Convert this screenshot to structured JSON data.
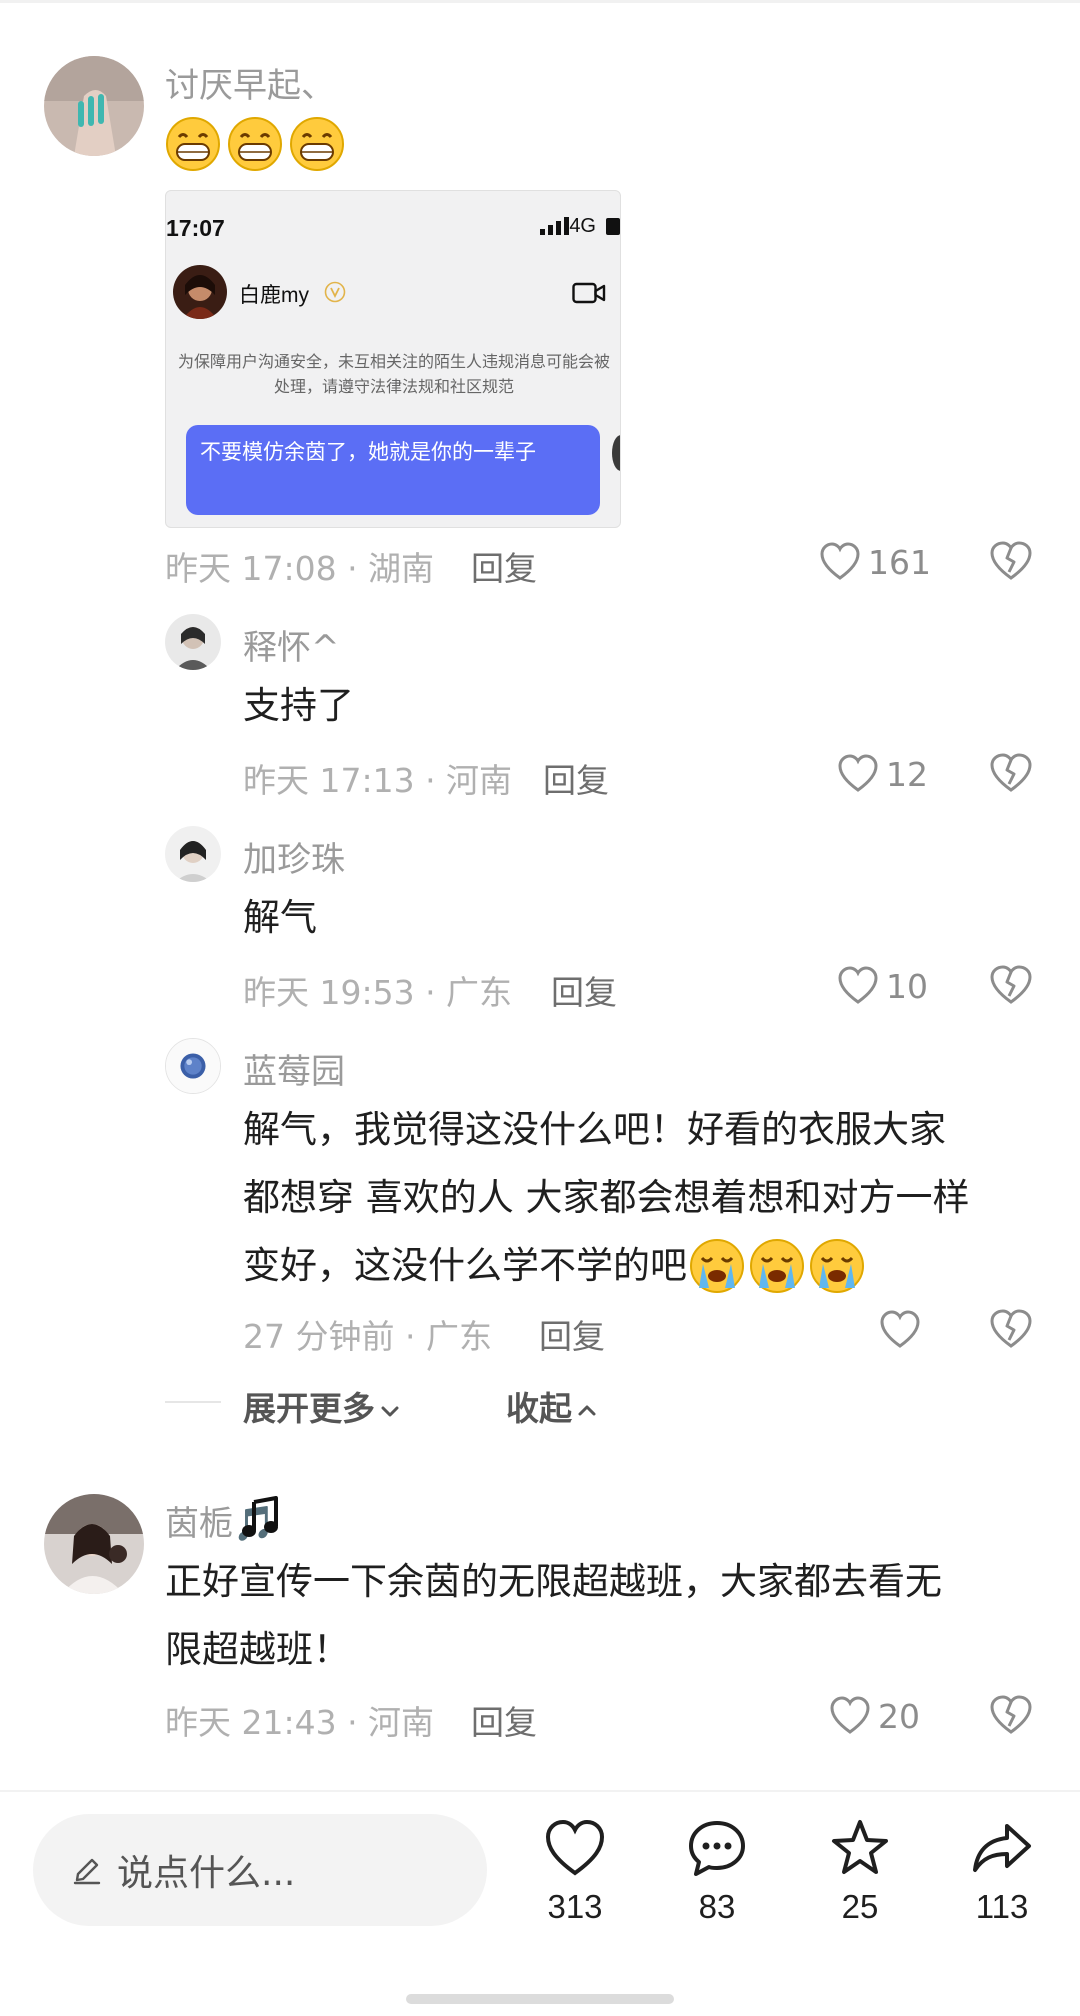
{
  "comments": [
    {
      "username": "讨厌早起、",
      "emoji_text": "😁😁😁",
      "emojis": [
        "grin-emoji",
        "grin-emoji",
        "grin-emoji"
      ],
      "screenshot": {
        "time": "17:07",
        "network": "4G",
        "contact_name": "白鹿my",
        "notice": "为保障用户沟通安全，未互相关注的陌生人违规消息可能会被处理，请遵守法律法规和社区规范",
        "message": "不要模仿余茵了，她就是你的一辈子"
      },
      "meta": "昨天 17:08 · 湖南",
      "reply_label": "回复",
      "likes": "161"
    },
    {
      "username": "释怀^",
      "text": "支持了",
      "meta": "昨天 17:13 · 河南",
      "reply_label": "回复",
      "likes": "12"
    },
    {
      "username": "加珍珠",
      "text": "解气",
      "meta": "昨天 19:53 · 广东",
      "reply_label": "回复",
      "likes": "10"
    },
    {
      "username": "蓝莓园",
      "text_lines": [
        "解气，我觉得这没什么吧！好看的衣服大家",
        "都想穿 喜欢的人 大家都会想着想和对方一样",
        "变好，这没什么学不学的吧"
      ],
      "meta": "27 分钟前 · 广东",
      "reply_label": "回复",
      "likes": ""
    },
    {
      "username": "茵栀🎵",
      "text_lines": [
        "正好宣传一下余茵的无限超越班，大家都去看无",
        "限超越班！"
      ],
      "meta": "昨天 21:43 · 河南",
      "reply_label": "回复",
      "likes": "20"
    }
  ],
  "thread_controls": {
    "expand_more": "展开更多",
    "collapse": "收起"
  },
  "bottom_bar": {
    "input_placeholder": "说点什么...",
    "likes": "313",
    "comments": "83",
    "favorites": "25",
    "shares": "113"
  },
  "colors": {
    "bubble": "#5b6ef5",
    "muted_text": "#9a9a9a",
    "meta_text": "#b0b0b0"
  }
}
